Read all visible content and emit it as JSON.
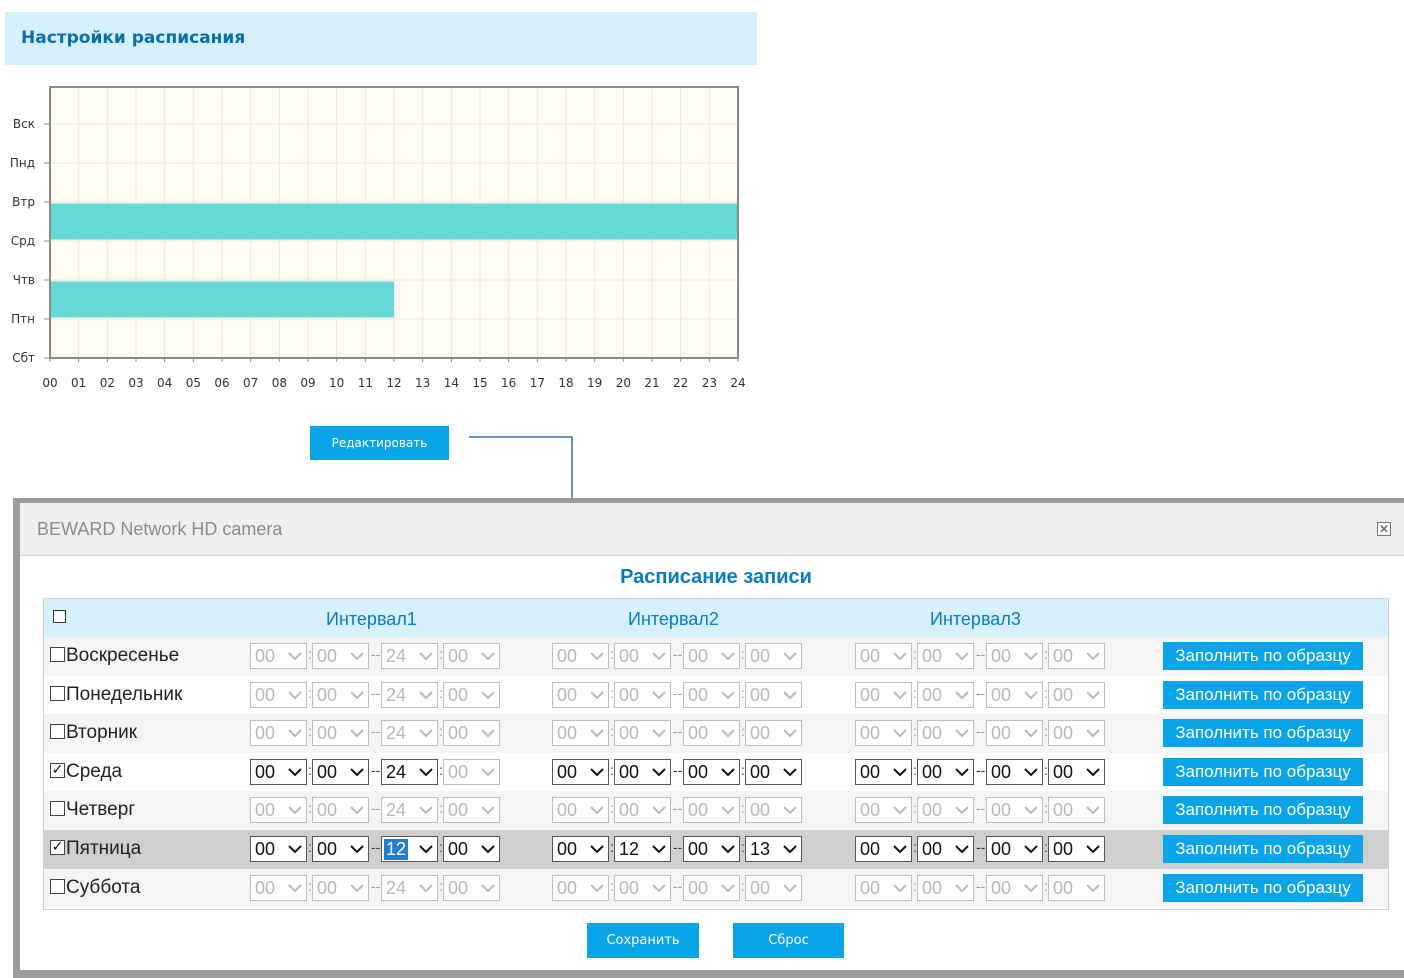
{
  "page": {
    "title": "Настройки расписания"
  },
  "chart_data": {
    "type": "heatmap",
    "days": [
      "Вск",
      "Пнд",
      "Втр",
      "Срд",
      "Чтв",
      "Птн",
      "Сбт"
    ],
    "hours": [
      "00",
      "01",
      "02",
      "03",
      "04",
      "05",
      "06",
      "07",
      "08",
      "09",
      "10",
      "11",
      "12",
      "13",
      "14",
      "15",
      "16",
      "17",
      "18",
      "19",
      "20",
      "21",
      "22",
      "23",
      "24"
    ],
    "xlim": [
      0,
      24
    ],
    "bars": [
      {
        "day": "Срд",
        "start": 0,
        "end": 24
      },
      {
        "day": "Птн",
        "start": 0,
        "end": 12
      }
    ],
    "bar_color": "#66d9d6",
    "grid": true
  },
  "edit_button": {
    "label": "Редактировать"
  },
  "modal": {
    "title": "BEWARD Network HD camera",
    "heading": "Расписание записи",
    "intervals": [
      "Интервал1",
      "Интервал2",
      "Интервал3"
    ],
    "fill_label": "Заполнить по образцу",
    "days": [
      {
        "name": "Воскресенье",
        "checked": false,
        "checkmark": "",
        "i1": [
          "00",
          "00",
          "24",
          "00"
        ],
        "i2": [
          "00",
          "00",
          "00",
          "00"
        ],
        "i3": [
          "00",
          "00",
          "00",
          "00"
        ]
      },
      {
        "name": "Понедельник",
        "checked": false,
        "checkmark": "",
        "i1": [
          "00",
          "00",
          "24",
          "00"
        ],
        "i2": [
          "00",
          "00",
          "00",
          "00"
        ],
        "i3": [
          "00",
          "00",
          "00",
          "00"
        ]
      },
      {
        "name": "Вторник",
        "checked": false,
        "checkmark": "",
        "i1": [
          "00",
          "00",
          "24",
          "00"
        ],
        "i2": [
          "00",
          "00",
          "00",
          "00"
        ],
        "i3": [
          "00",
          "00",
          "00",
          "00"
        ]
      },
      {
        "name": "Среда",
        "checked": true,
        "checkmark": "✓",
        "i1": [
          "00",
          "00",
          "24",
          "00"
        ],
        "i2": [
          "00",
          "00",
          "00",
          "00"
        ],
        "i3": [
          "00",
          "00",
          "00",
          "00"
        ]
      },
      {
        "name": "Четверг",
        "checked": false,
        "checkmark": "",
        "i1": [
          "00",
          "00",
          "24",
          "00"
        ],
        "i2": [
          "00",
          "00",
          "00",
          "00"
        ],
        "i3": [
          "00",
          "00",
          "00",
          "00"
        ]
      },
      {
        "name": "Пятница",
        "checked": true,
        "checkmark": "✓",
        "i1": [
          "00",
          "00",
          "12",
          "00"
        ],
        "i2": [
          "00",
          "12",
          "00",
          "13"
        ],
        "i3": [
          "00",
          "00",
          "00",
          "00"
        ]
      },
      {
        "name": "Суббота",
        "checked": false,
        "checkmark": "",
        "i1": [
          "00",
          "00",
          "24",
          "00"
        ],
        "i2": [
          "00",
          "00",
          "00",
          "00"
        ],
        "i3": [
          "00",
          "00",
          "00",
          "00"
        ]
      }
    ],
    "save_label": "Сохранить",
    "reset_label": "Сброс",
    "close_glyph": "✕"
  }
}
